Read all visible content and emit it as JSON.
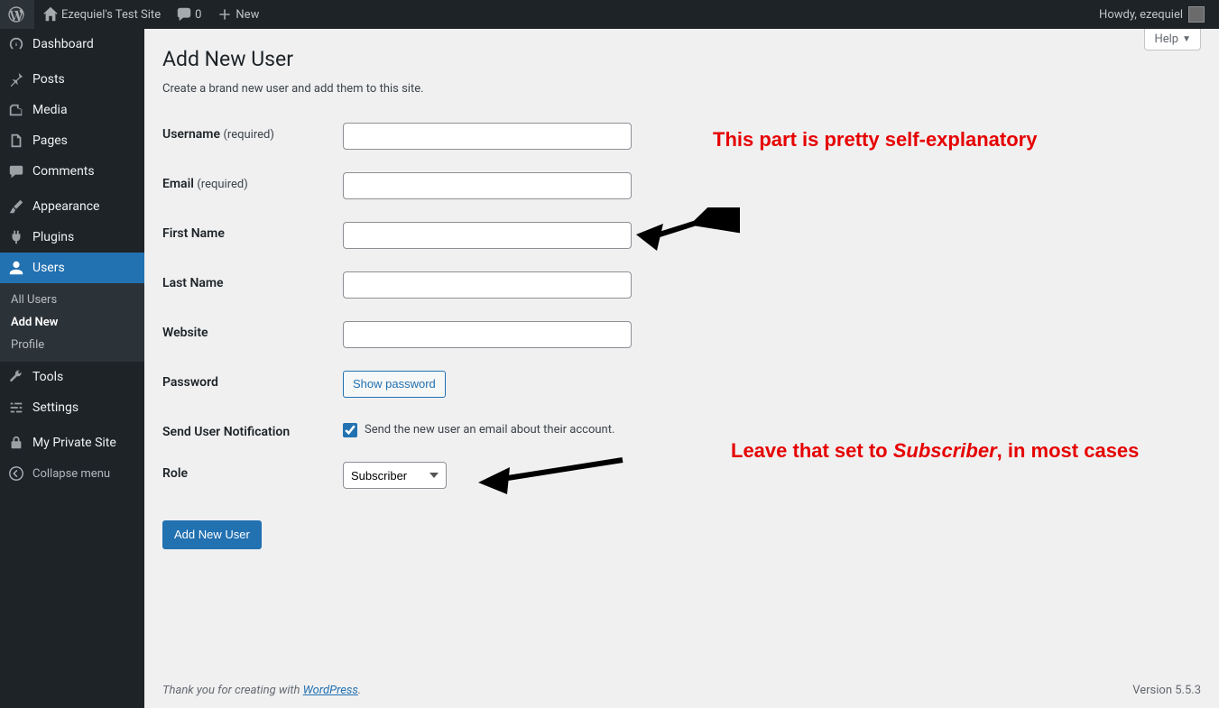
{
  "adminbar": {
    "site_name": "Ezequiel's Test Site",
    "comments_count": "0",
    "new_label": "New",
    "howdy_prefix": "Howdy, ",
    "user_name": "ezequiel"
  },
  "sidemenu": {
    "dashboard": "Dashboard",
    "posts": "Posts",
    "media": "Media",
    "pages": "Pages",
    "comments": "Comments",
    "appearance": "Appearance",
    "plugins": "Plugins",
    "users": "Users",
    "users_sub": {
      "all": "All Users",
      "add": "Add New",
      "profile": "Profile"
    },
    "tools": "Tools",
    "settings": "Settings",
    "private": "My Private Site",
    "collapse": "Collapse menu"
  },
  "screen": {
    "help": "Help"
  },
  "page": {
    "title": "Add New User",
    "subtitle": "Create a brand new user and add them to this site."
  },
  "form": {
    "username_label": "Username",
    "username_req": "(required)",
    "email_label": "Email",
    "email_req": "(required)",
    "firstname_label": "First Name",
    "lastname_label": "Last Name",
    "website_label": "Website",
    "password_label": "Password",
    "show_password_btn": "Show password",
    "notify_label": "Send User Notification",
    "notify_checkbox_label": "Send the new user an email about their account.",
    "notify_checked": true,
    "role_label": "Role",
    "role_value": "Subscriber",
    "submit": "Add New User"
  },
  "footer": {
    "thank_pre": "Thank you for creating with ",
    "thank_link": "WordPress",
    "thank_post": ".",
    "version": "Version 5.5.3"
  },
  "annotations": {
    "top": "This part is pretty self-explanatory",
    "bottom_pre": "Leave that set to ",
    "bottom_em": "Subscriber",
    "bottom_post": ", in most cases"
  }
}
